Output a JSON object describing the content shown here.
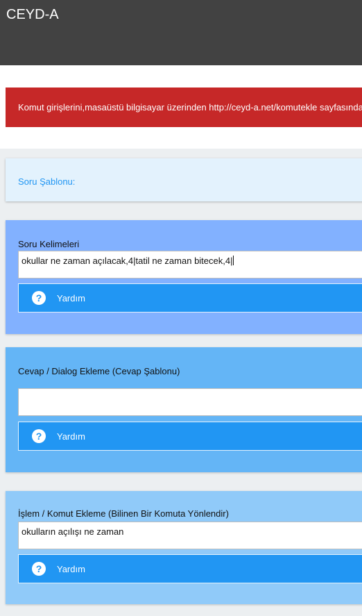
{
  "header": {
    "title": "CEYD-A"
  },
  "alert": {
    "text": "Komut girişlerini,masaüstü bilgisayar üzerinden http://ceyd-a.net/komutekle sayfasından"
  },
  "template": {
    "label": "Soru Şablonu:"
  },
  "sections": [
    {
      "label": "Soru Kelimeleri",
      "value": "okullar ne zaman açılacak,4|tatil ne zaman bitecek,4|",
      "help_label": "Yardım",
      "help_icon": "help-circle-icon"
    },
    {
      "label": "Cevap / Dialog Ekleme (Cevap Şablonu)",
      "value": "",
      "help_label": "Yardım",
      "help_icon": "help-circle-icon"
    },
    {
      "label": "İşlem / Komut Ekleme (Bilinen Bir Komuta Yönlendir)",
      "value": "okulların açılışı ne zaman",
      "help_label": "Yardım",
      "help_icon": "help-circle-icon"
    }
  ],
  "colors": {
    "header_bg": "#424242",
    "alert_bg": "#c62828",
    "template_bg": "#e3f2fd",
    "section1_bg": "#82b1ff",
    "section2_bg": "#64b5f6",
    "section3_bg": "#90caf9",
    "button_bg": "#2196f3"
  }
}
